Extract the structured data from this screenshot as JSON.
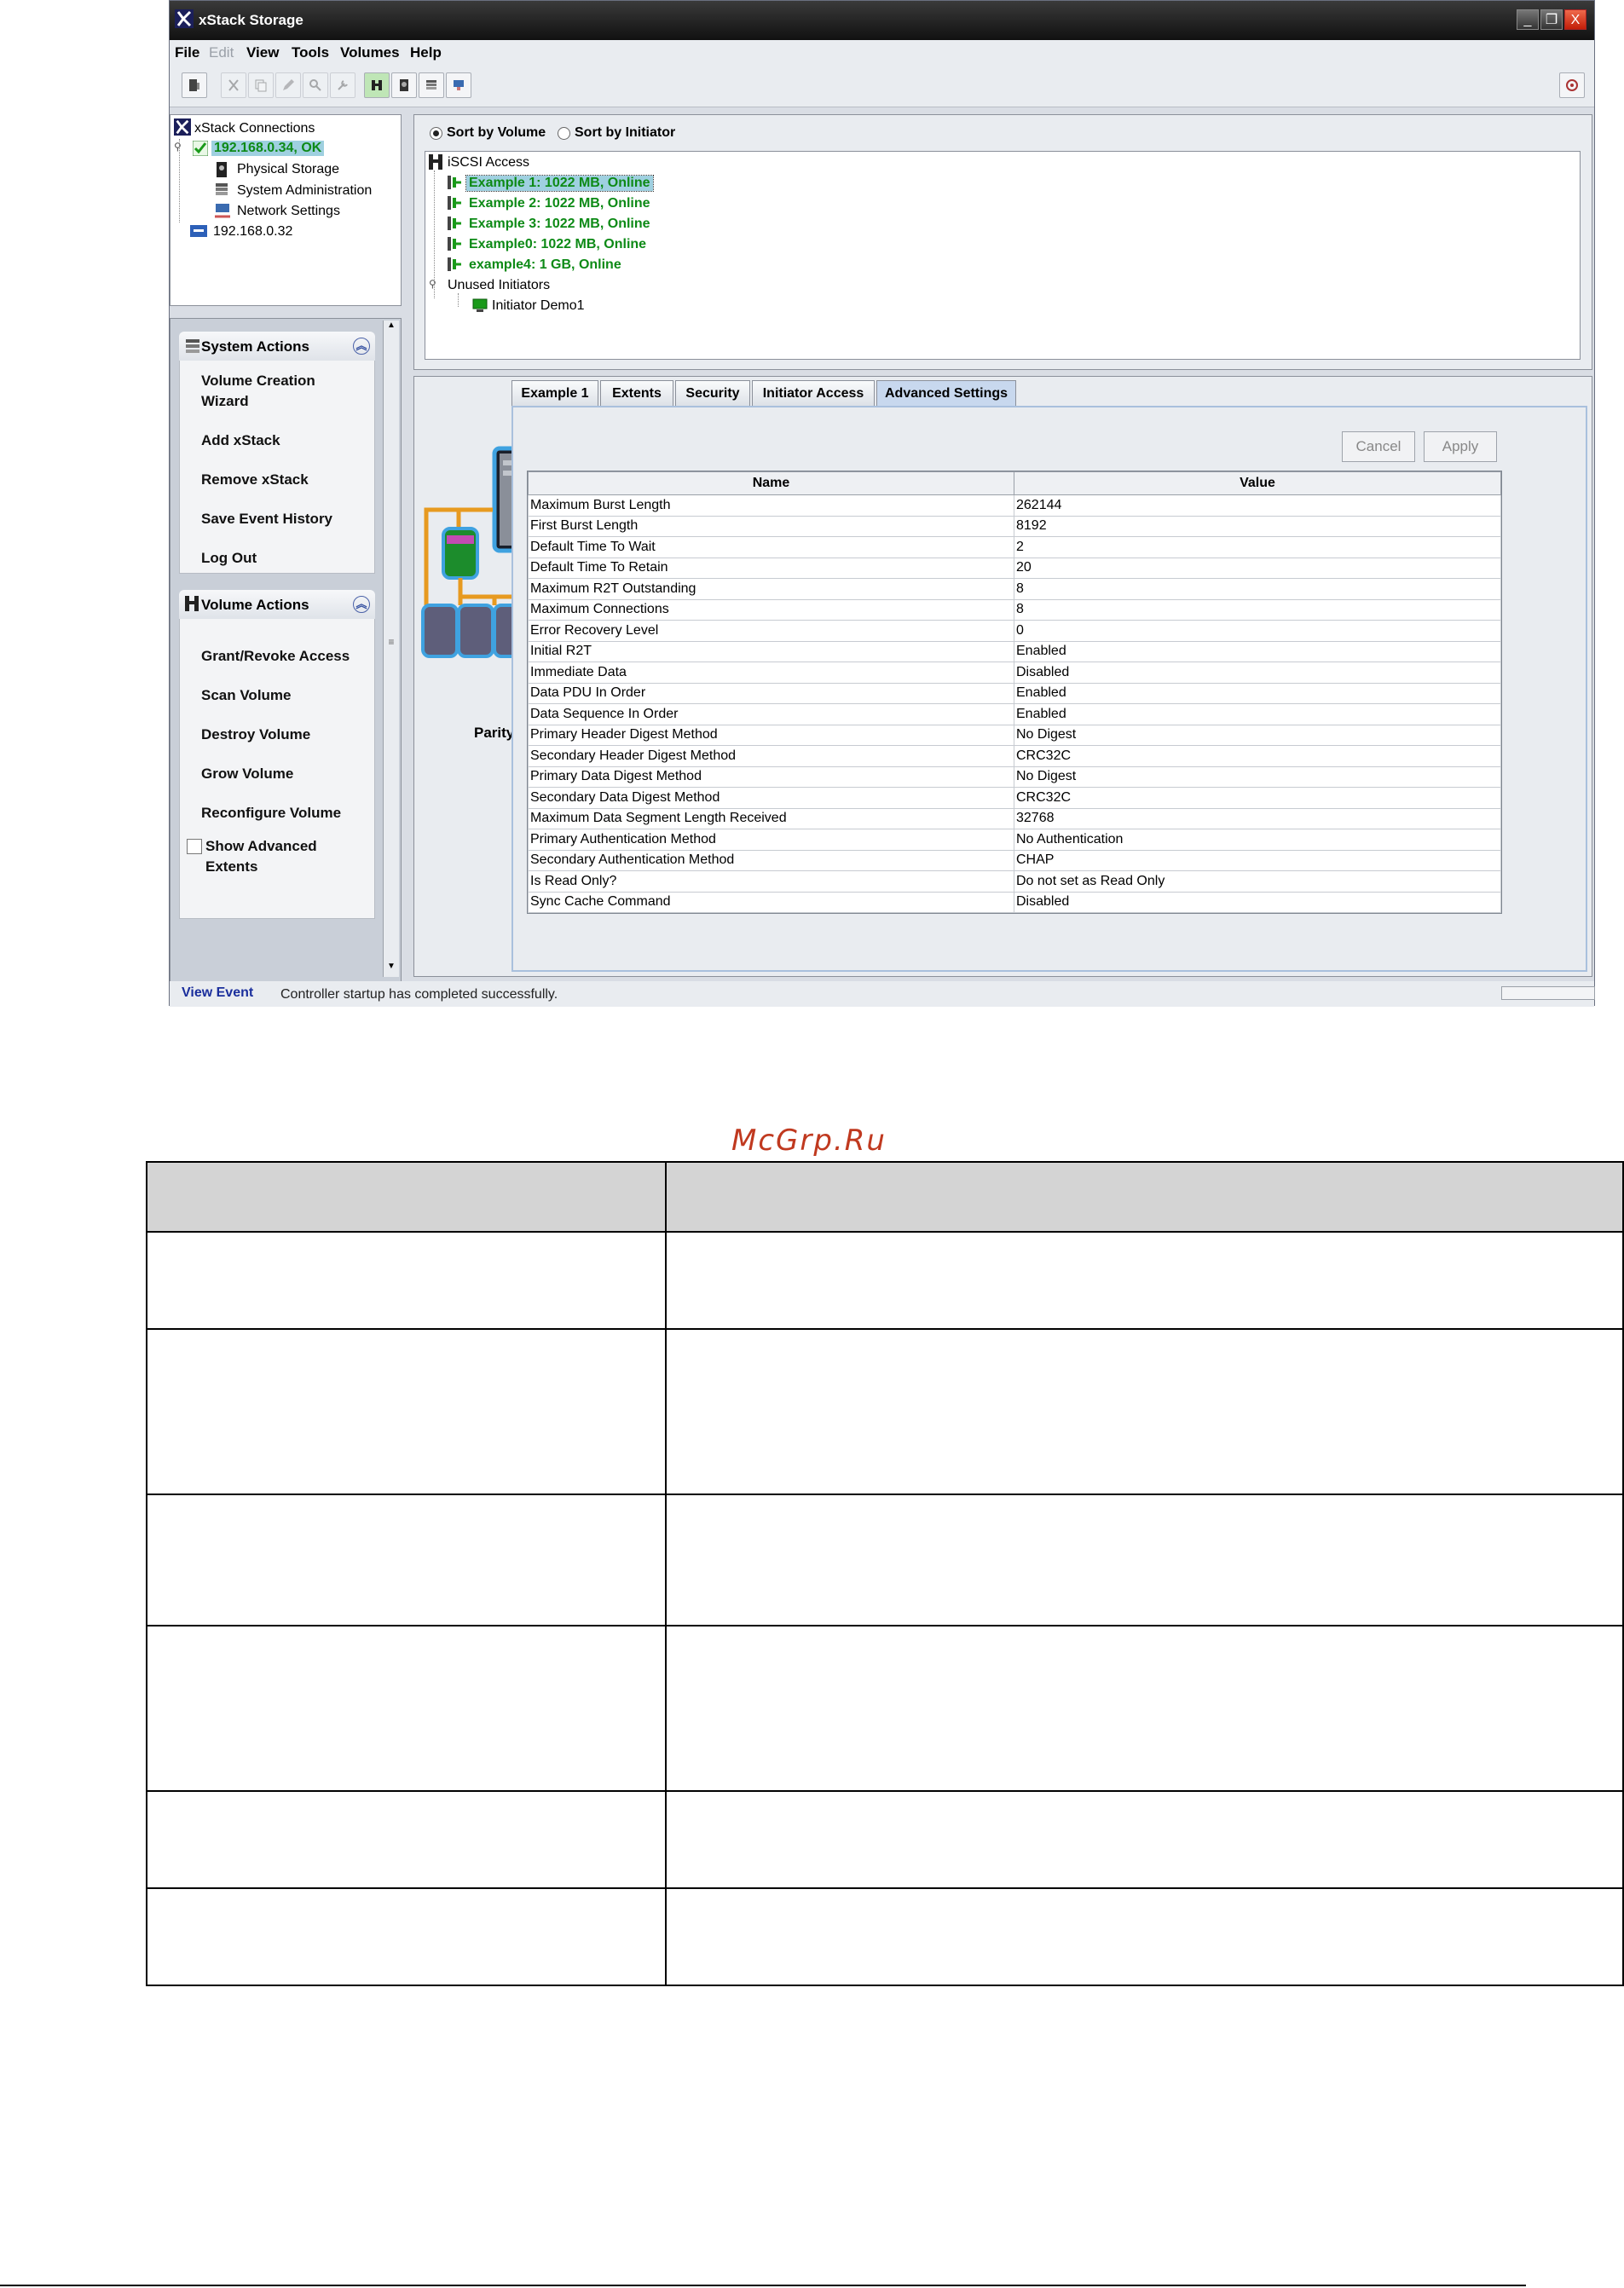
{
  "window": {
    "title": "xStack Storage",
    "controls": {
      "minimize": "_",
      "restore": "❐",
      "close": "X"
    }
  },
  "menu": [
    {
      "label": "File",
      "disabled": false
    },
    {
      "label": "Edit",
      "disabled": true
    },
    {
      "label": "View",
      "disabled": false
    },
    {
      "label": "Tools",
      "disabled": false
    },
    {
      "label": "Volumes",
      "disabled": false
    },
    {
      "label": "Help",
      "disabled": false
    }
  ],
  "connections": {
    "title": "xStack Connections",
    "nodes": [
      {
        "label": "192.168.0.34, OK"
      },
      {
        "label": "Physical Storage"
      },
      {
        "label": "System Administration"
      },
      {
        "label": "Network Settings"
      },
      {
        "label": "192.168.0.32"
      }
    ]
  },
  "system_actions": {
    "title": "System Actions",
    "collapse_glyph": "︽",
    "items": [
      "Volume Creation\nWizard",
      "Add xStack",
      "Remove xStack",
      "Save Event History",
      "Log Out"
    ]
  },
  "volume_actions": {
    "title": "Volume Actions",
    "collapse_glyph": "︽",
    "items": [
      "Grant/Revoke Access",
      "Scan Volume",
      "Destroy Volume",
      "Grow Volume",
      "Reconfigure Volume"
    ],
    "checkbox_label": "Show Advanced\nExtents"
  },
  "sort": {
    "by_volume": "Sort by Volume",
    "by_initiator": "Sort by Initiator",
    "selected": "by_volume"
  },
  "iscsi_tree": {
    "root": "iSCSI Access",
    "volumes": [
      "Example 1: 1022 MB, Online",
      "Example 2: 1022 MB, Online",
      "Example 3: 1022 MB, Online",
      "Example0: 1022 MB, Online",
      "example4: 1 GB, Online"
    ],
    "unused_root": "Unused Initiators",
    "unused": [
      "Initiator Demo1"
    ]
  },
  "raid_label": "Parity",
  "tabs": [
    "Example 1",
    "Extents",
    "Security",
    "Initiator Access",
    "Advanced Settings"
  ],
  "active_tab": "Advanced Settings",
  "buttons": {
    "cancel": "Cancel",
    "apply": "Apply"
  },
  "settings": {
    "columns": [
      "Name",
      "Value"
    ],
    "rows": [
      [
        "Maximum Burst Length",
        "262144"
      ],
      [
        "First Burst Length",
        "8192"
      ],
      [
        "Default Time To Wait",
        "2"
      ],
      [
        "Default Time To Retain",
        "20"
      ],
      [
        "Maximum R2T Outstanding",
        "8"
      ],
      [
        "Maximum Connections",
        "8"
      ],
      [
        "Error Recovery Level",
        "0"
      ],
      [
        "Initial R2T",
        "Enabled"
      ],
      [
        "Immediate Data",
        "Disabled"
      ],
      [
        "Data PDU In Order",
        "Enabled"
      ],
      [
        "Data Sequence In Order",
        "Enabled"
      ],
      [
        "Primary Header Digest Method",
        "No Digest"
      ],
      [
        "Secondary Header Digest Method",
        "CRC32C"
      ],
      [
        "Primary Data Digest Method",
        "No Digest"
      ],
      [
        "Secondary Data Digest Method",
        "CRC32C"
      ],
      [
        "Maximum Data Segment Length Received",
        "32768"
      ],
      [
        "Primary Authentication Method",
        "No Authentication"
      ],
      [
        "Secondary Authentication Method",
        "CHAP"
      ],
      [
        "Is Read Only?",
        "Do not set as Read Only"
      ],
      [
        "Sync Cache Command",
        "Disabled"
      ]
    ]
  },
  "status": {
    "link": "View Event",
    "message": "Controller startup has completed successfully."
  },
  "watermark": "McGrp.Ru",
  "colors": {
    "volume_green": "#0d8a16",
    "selection": "#9fd0e0",
    "accent_blue": "#1a2e9c"
  }
}
